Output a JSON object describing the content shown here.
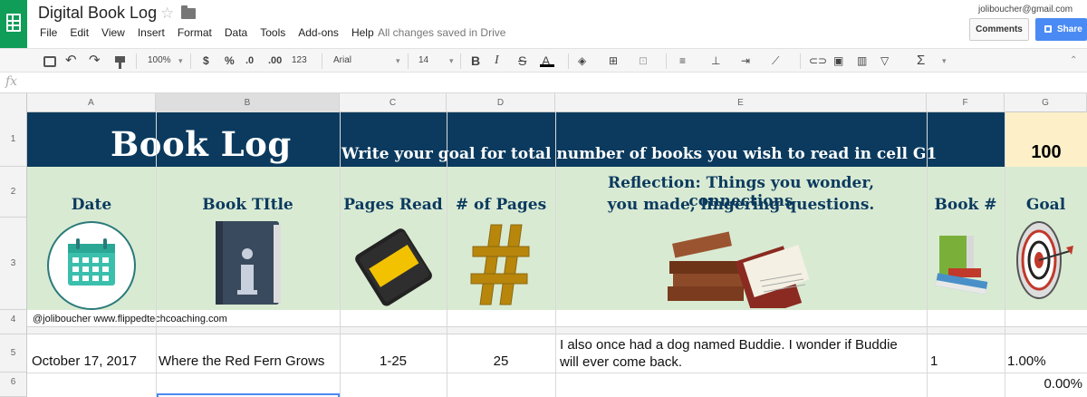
{
  "app": {
    "doc_title": "Digital Book Log",
    "menu": [
      "File",
      "Edit",
      "View",
      "Insert",
      "Format",
      "Data",
      "Tools",
      "Add-ons",
      "Help"
    ],
    "save_status": "All changes saved in Drive",
    "user_email": "joliboucher@gmail.com",
    "comments_label": "Comments",
    "share_label": "Share"
  },
  "toolbar": {
    "zoom": "100%",
    "currency": "$",
    "percent": "%",
    "dec_less": ".0",
    "dec_more": ".00",
    "format_more": "123",
    "font": "Arial",
    "font_size": "14",
    "bold": "B",
    "italic": "I",
    "strike": "S",
    "text_color": "A",
    "function": "Σ"
  },
  "formula": {
    "fx": "fx",
    "value": ""
  },
  "columns": [
    "A",
    "B",
    "C",
    "D",
    "E",
    "F",
    "G"
  ],
  "rows": [
    "1",
    "2",
    "3",
    "4",
    "5",
    "6"
  ],
  "banner": {
    "title": "Book Log",
    "instruction": "Write your goal for total number of books you wish to read in cell G1",
    "goal_value": "100"
  },
  "headers": {
    "date": "Date",
    "book_title": "Book TItle",
    "pages_read": "Pages Read",
    "num_pages": "# of Pages",
    "reflection_line1": "Reflection: Things you wonder, connections",
    "reflection_line2": "you made, lingering questions.",
    "book_num": "Book #",
    "goal": "Goal"
  },
  "credit": "@joliboucher www.flippedtechcoaching.com",
  "entries": [
    {
      "date": "October 17, 2017",
      "title": "Where the Red Fern Grows",
      "pages_read": "1-25",
      "num_pages": "25",
      "reflection_line1": "I also once had a dog named Buddie. I wonder if Buddie",
      "reflection_line2": "will ever come back.",
      "book_num": "1",
      "goal_pct": "1.00%"
    }
  ],
  "row6_goal_pct": "0.00%",
  "colors": {
    "banner": "#0b3a5e",
    "header_bg": "#d9ead3",
    "goal_bg": "#fdf0c8",
    "sheets_green": "#0f9d58",
    "share_blue": "#4a8af4"
  },
  "icons": [
    "calendar-icon",
    "info-book-icon",
    "notebook-icon",
    "hash-icon",
    "books-stack-icon",
    "small-books-icon",
    "target-icon"
  ]
}
